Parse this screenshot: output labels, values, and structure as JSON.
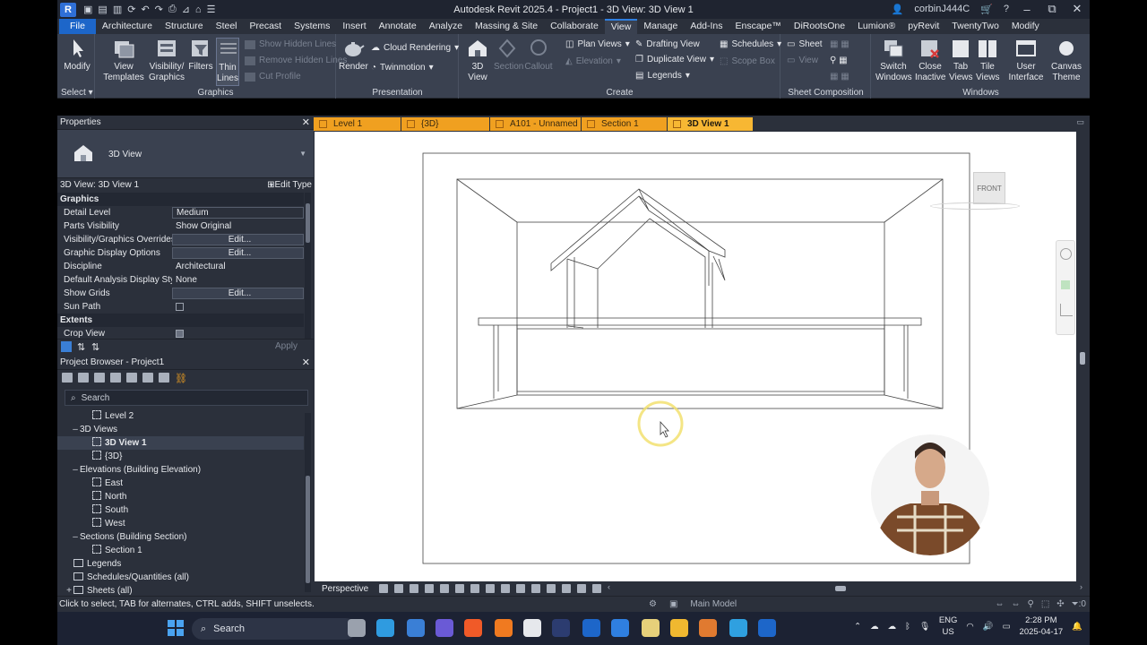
{
  "window": {
    "title": "Autodesk Revit 2025.4 - Project1 - 3D View: 3D View 1",
    "app_logo": "R",
    "user": "corbinJ444C",
    "controls": {
      "minimize": "–",
      "maximize": "⧉",
      "close": "✕"
    }
  },
  "ribbon_tabs": [
    "File",
    "Architecture",
    "Structure",
    "Steel",
    "Precast",
    "Systems",
    "Insert",
    "Annotate",
    "Analyze",
    "Massing & Site",
    "Collaborate",
    "View",
    "Manage",
    "Add-Ins",
    "Enscape™",
    "DiRootsOne",
    "Lumion®",
    "pyRevit",
    "TwentyTwo",
    "Modify"
  ],
  "ribbon": {
    "select": {
      "modify": "Modify",
      "panel": "Select"
    },
    "graphics": {
      "view_templates": "View Templates",
      "visibility_graphics": "Visibility/ Graphics",
      "filters": "Filters",
      "thin_lines": "Thin Lines",
      "show_hidden_lines": "Show Hidden Lines",
      "remove_hidden_lines": "Remove Hidden Lines",
      "cut_profile": "Cut Profile",
      "panel": "Graphics"
    },
    "presentation": {
      "render": "Render",
      "cloud_rendering": "Cloud Rendering",
      "twinmotion": "Twinmotion",
      "panel": "Presentation"
    },
    "create": {
      "view_3d": "3D View",
      "section": "Section",
      "callout": "Callout",
      "plan_views": "Plan Views",
      "elevation": "Elevation",
      "drafting_view": "Drafting View",
      "duplicate_view": "Duplicate View",
      "legends": "Legends",
      "schedules": "Schedules",
      "scope_box": "Scope Box",
      "panel": "Create"
    },
    "sheet_composition": {
      "sheet": "Sheet",
      "view": "View",
      "panel": "Sheet Composition"
    },
    "windows": {
      "switch_windows": "Switch Windows",
      "close_inactive": "Close Inactive",
      "tab_views": "Tab Views",
      "tile_views": "Tile Views",
      "user_interface": "User Interface",
      "canvas_theme": "Canvas Theme",
      "panel": "Windows"
    }
  },
  "properties": {
    "title": "Properties",
    "type_name": "3D View",
    "view_selector": "3D View: 3D View 1",
    "edit_type": "Edit Type",
    "apply": "Apply",
    "groups": {
      "graphics": "Graphics",
      "extents": "Extents"
    },
    "rows": [
      {
        "k": "Detail Level",
        "v": "Medium",
        "kind": "sel"
      },
      {
        "k": "Parts Visibility",
        "v": "Show Original",
        "kind": "text"
      },
      {
        "k": "Visibility/Graphics Overrides",
        "v": "Edit...",
        "kind": "btn"
      },
      {
        "k": "Graphic Display Options",
        "v": "Edit...",
        "kind": "btn"
      },
      {
        "k": "Discipline",
        "v": "Architectural",
        "kind": "text"
      },
      {
        "k": "Default Analysis Display Style",
        "v": "None",
        "kind": "text"
      },
      {
        "k": "Show Grids",
        "v": "Edit...",
        "kind": "btn"
      },
      {
        "k": "Sun Path",
        "v": "",
        "kind": "check",
        "checked": false
      }
    ],
    "crop_view": {
      "k": "Crop View",
      "checked": true
    }
  },
  "project_browser": {
    "title": "Project Browser - Project1",
    "search_placeholder": "Search",
    "nodes": [
      {
        "label": "Level 2",
        "indent": 3,
        "type": "view"
      },
      {
        "label": "3D Views",
        "indent": 1,
        "type": "group",
        "toggle": "–"
      },
      {
        "label": "3D View 1",
        "indent": 3,
        "type": "view",
        "selected": true
      },
      {
        "label": "{3D}",
        "indent": 3,
        "type": "view"
      },
      {
        "label": "Elevations (Building Elevation)",
        "indent": 1,
        "type": "group",
        "toggle": "–"
      },
      {
        "label": "East",
        "indent": 3,
        "type": "view"
      },
      {
        "label": "North",
        "indent": 3,
        "type": "view"
      },
      {
        "label": "South",
        "indent": 3,
        "type": "view"
      },
      {
        "label": "West",
        "indent": 3,
        "type": "view"
      },
      {
        "label": "Sections (Building Section)",
        "indent": 1,
        "type": "group",
        "toggle": "–"
      },
      {
        "label": "Section 1",
        "indent": 3,
        "type": "view"
      },
      {
        "label": "Legends",
        "indent": 0,
        "type": "folder"
      },
      {
        "label": "Schedules/Quantities (all)",
        "indent": 0,
        "type": "folder"
      },
      {
        "label": "Sheets (all)",
        "indent": 0,
        "type": "folder",
        "toggle": "+"
      }
    ]
  },
  "doc_tabs": [
    {
      "label": "Level 1",
      "active": false
    },
    {
      "label": "{3D}",
      "active": false
    },
    {
      "label": "A101 - Unnamed",
      "active": false
    },
    {
      "label": "Section 1",
      "active": false
    },
    {
      "label": "3D View 1",
      "active": true
    }
  ],
  "viewcube": {
    "face": "FRONT"
  },
  "view_control_bar": {
    "mode": "Perspective"
  },
  "status": {
    "message": "Click to select, TAB for alternates, CTRL adds, SHIFT unselects.",
    "model": "Main Model",
    "filter_count": ":0"
  },
  "taskbar": {
    "search": "Search",
    "lang": [
      "ENG",
      "US"
    ],
    "time": "2:28 PM",
    "date": "2025-04-17"
  }
}
